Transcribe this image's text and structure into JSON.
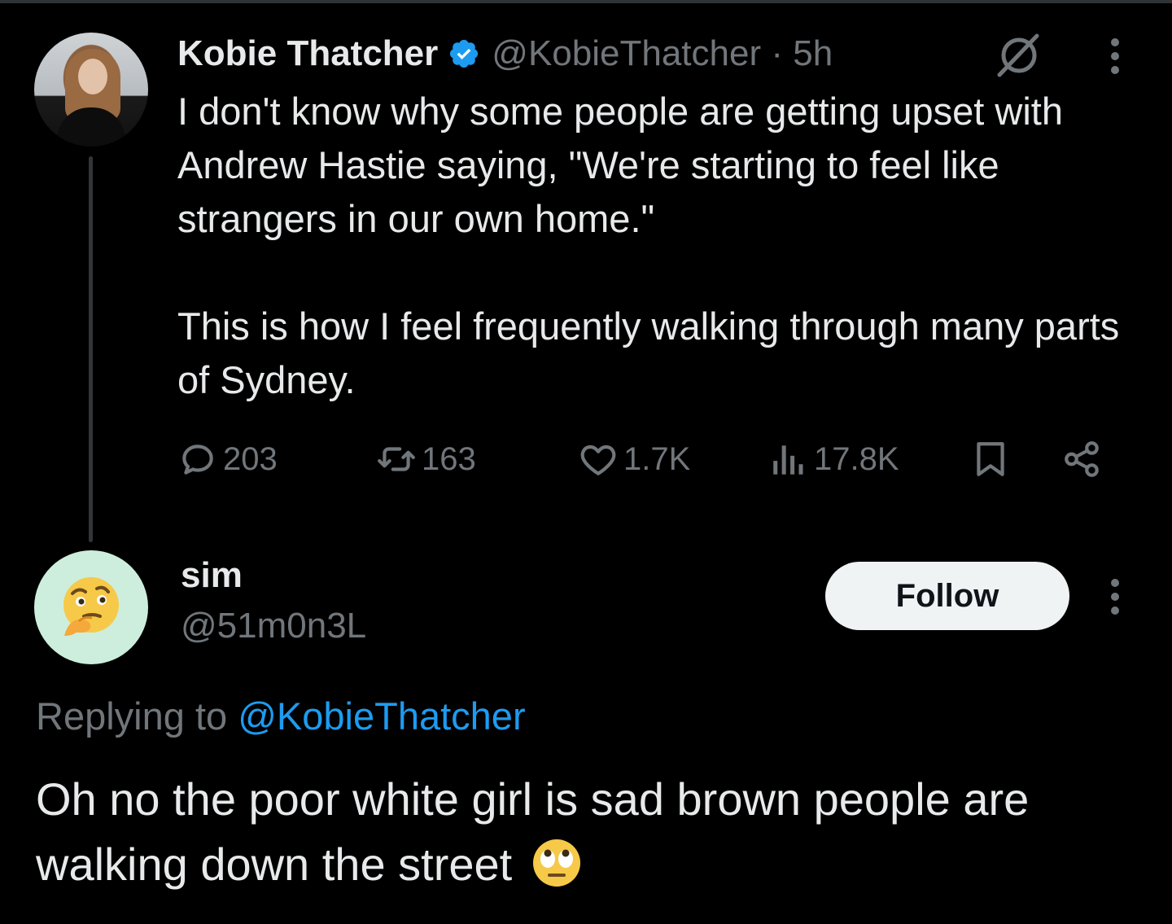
{
  "parent_tweet": {
    "display_name": "Kobie Thatcher",
    "handle_time": "@KobieThatcher · 5h",
    "paragraphs": [
      "I don't know why some people are getting upset with Andrew Hastie saying, \"We're starting to feel like strangers in our own home.\"",
      "This is how I feel frequently walking through many parts of Sydney."
    ],
    "icons": {
      "verified": "verified-badge-icon",
      "grok": "grok-icon",
      "more": "more-options-icon"
    },
    "actions": {
      "replies": "203",
      "reposts": "163",
      "likes": "1.7K",
      "views": "17.8K"
    }
  },
  "reply": {
    "display_name": "sim",
    "handle": "@51m0n3L",
    "follow_label": "Follow",
    "replying_to_label": "Replying to ",
    "replying_to_mention": "@KobieThatcher",
    "text": "Oh no the poor white girl is sad brown people are walking down the street",
    "avatar_emoji": "thinking-face",
    "trailing_emoji": "face-with-rolling-eyes"
  },
  "colors": {
    "background": "#000000",
    "primary_text": "#e7e9ea",
    "secondary_text": "#71767b",
    "link": "#1d9bf0",
    "verified": "#1d9bf0",
    "follow_button_bg": "#eff3f4",
    "thread_line": "#333639",
    "sim_avatar_bg": "#cdeedd"
  }
}
